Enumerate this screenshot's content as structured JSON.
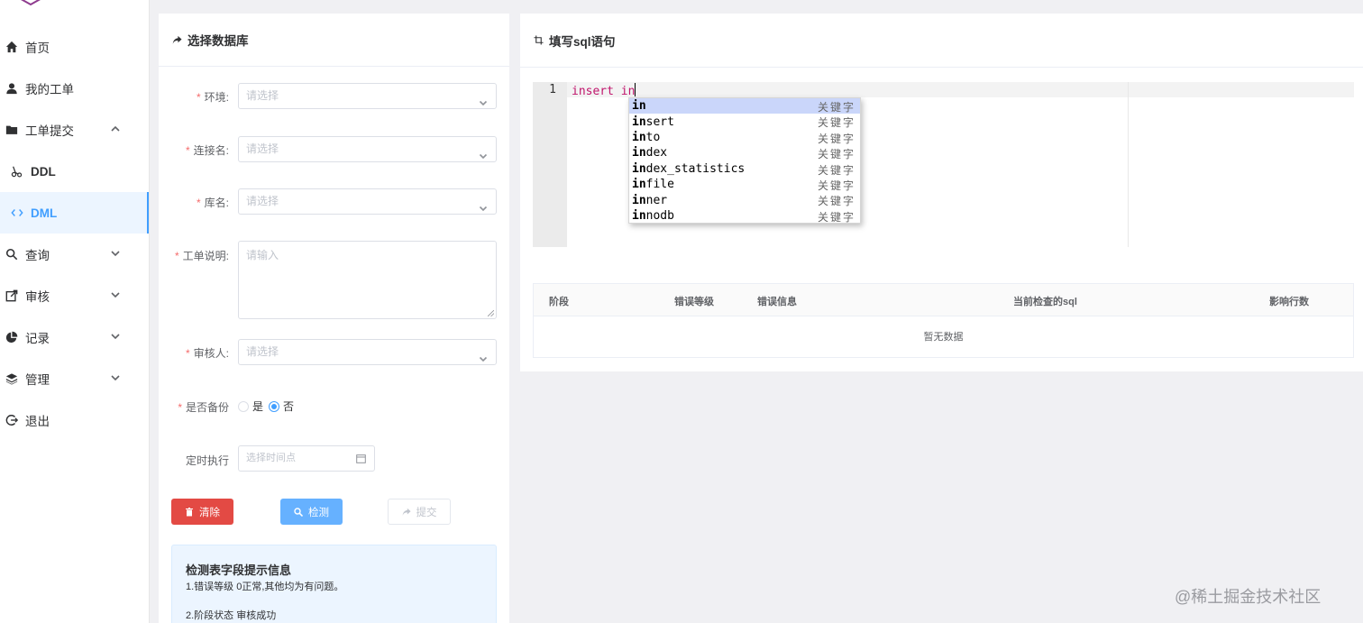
{
  "sidebar": {
    "items": [
      {
        "label": "首页",
        "icon": "home-icon"
      },
      {
        "label": "我的工单",
        "icon": "user-icon"
      },
      {
        "label": "工单提交",
        "icon": "folder-icon",
        "expanded": true
      },
      {
        "label": "DDL",
        "icon": "scissors-icon"
      },
      {
        "label": "DML",
        "icon": "code-icon",
        "active": true
      },
      {
        "label": "查询",
        "icon": "search-icon"
      },
      {
        "label": "审核",
        "icon": "edit-icon"
      },
      {
        "label": "记录",
        "icon": "pie-chart-icon"
      },
      {
        "label": "管理",
        "icon": "layers-icon"
      },
      {
        "label": "退出",
        "icon": "logout-icon"
      }
    ]
  },
  "left_panel": {
    "title": "选择数据库",
    "form": {
      "env_label": "环境:",
      "env_placeholder": "请选择",
      "conn_label": "连接名:",
      "conn_placeholder": "请选择",
      "db_label": "库名:",
      "db_placeholder": "请选择",
      "desc_label": "工单说明:",
      "desc_placeholder": "请输入",
      "reviewer_label": "审核人:",
      "reviewer_placeholder": "请选择",
      "backup_label": "是否备份",
      "backup_yes": "是",
      "backup_no": "否",
      "backup_selected": "否",
      "schedule_label": "定时执行",
      "schedule_placeholder": "选择时间点"
    },
    "buttons": {
      "clear": "清除",
      "check": "检测",
      "submit": "提交"
    },
    "tip": {
      "title": "检测表字段提示信息",
      "line1": "1.错误等级 0正常,其他均为有问题。",
      "line2": "2.阶段状态 审核成功"
    }
  },
  "right_panel": {
    "title": "填写sql语句",
    "editor": {
      "line_number": "1",
      "code_keyword": "insert",
      "code_typed": "in"
    },
    "autocomplete": {
      "meta": "关键字",
      "prefix": "in",
      "items": [
        {
          "match": "in",
          "rest": ""
        },
        {
          "match": "in",
          "rest": "sert"
        },
        {
          "match": "in",
          "rest": "to"
        },
        {
          "match": "in",
          "rest": "dex"
        },
        {
          "match": "in",
          "rest": "dex_statistics"
        },
        {
          "match": "in",
          "rest": "file"
        },
        {
          "match": "in",
          "rest": "ner"
        },
        {
          "match": "in",
          "rest": "nodb"
        }
      ]
    },
    "table": {
      "columns": [
        "阶段",
        "错误等级",
        "错误信息",
        "当前检查的sql",
        "影响行数"
      ],
      "empty_text": "暂无数据"
    }
  },
  "watermark": "@稀土掘金技术社区",
  "colors": {
    "accent": "#409eff",
    "danger": "#e34a44",
    "primary_light": "#66b1ff",
    "keyword": "#c0156c",
    "autocomplete_selected": "#cad6fa"
  }
}
